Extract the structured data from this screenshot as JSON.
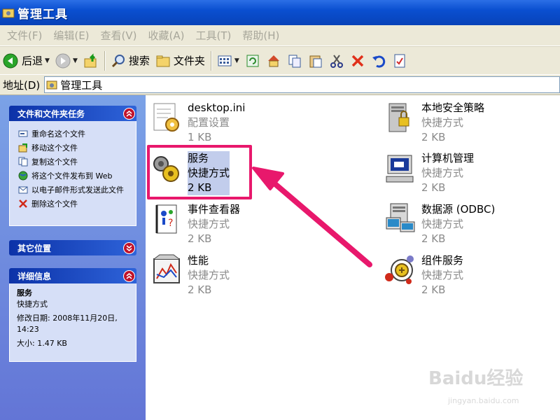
{
  "window": {
    "title": "管理工具"
  },
  "menu": [
    "文件(F)",
    "编辑(E)",
    "查看(V)",
    "收藏(A)",
    "工具(T)",
    "帮助(H)"
  ],
  "toolbar": {
    "back": "后退",
    "search": "搜索",
    "folders": "文件夹"
  },
  "address": {
    "label": "地址(D)",
    "value": "管理工具"
  },
  "tasks": {
    "title": "文件和文件夹任务",
    "items": [
      "重命名这个文件",
      "移动这个文件",
      "复制这个文件",
      "将这个文件发布到 Web",
      "以电子邮件形式发送此文件",
      "删除这个文件"
    ]
  },
  "other_places": {
    "title": "其它位置"
  },
  "details": {
    "title": "详细信息",
    "name": "服务",
    "type": "快捷方式",
    "modified": "修改日期: 2008年11月20日, 14:23",
    "size": "大小: 1.47 KB"
  },
  "files": [
    {
      "name": "desktop.ini",
      "type": "配置设置",
      "size": "1 KB",
      "icon": "ini-settings-icon"
    },
    {
      "name": "本地安全策略",
      "type": "快捷方式",
      "size": "2 KB",
      "icon": "security-policy-icon"
    },
    {
      "name": "服务",
      "type": "快捷方式",
      "size": "2 KB",
      "icon": "services-gear-icon"
    },
    {
      "name": "计算机管理",
      "type": "快捷方式",
      "size": "2 KB",
      "icon": "computer-management-icon"
    },
    {
      "name": "事件查看器",
      "type": "快捷方式",
      "size": "2 KB",
      "icon": "event-viewer-icon"
    },
    {
      "name": "数据源 (ODBC)",
      "type": "快捷方式",
      "size": "2 KB",
      "icon": "odbc-icon"
    },
    {
      "name": "性能",
      "type": "快捷方式",
      "size": "2 KB",
      "icon": "performance-icon"
    },
    {
      "name": "组件服务",
      "type": "快捷方式",
      "size": "2 KB",
      "icon": "component-services-icon"
    }
  ],
  "watermark": {
    "logo": "Baidu经验",
    "url": "jingyan.baidu.com"
  },
  "colors": {
    "title_bar": "#0a4fd0",
    "annotation": "#e8186c",
    "selection": "#c2cdec"
  }
}
